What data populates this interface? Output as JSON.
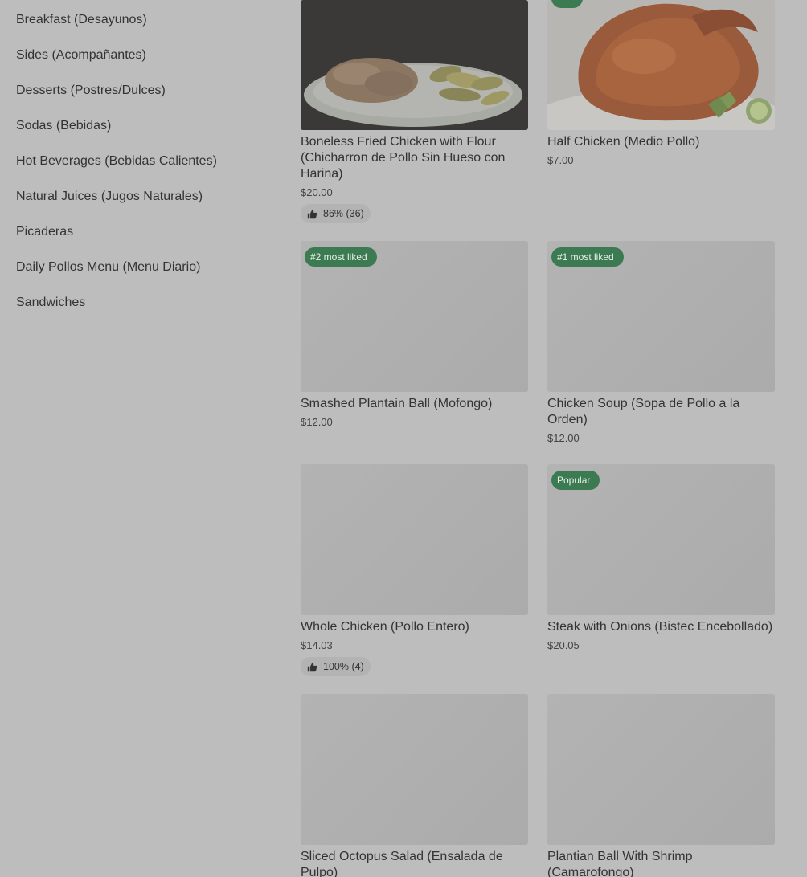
{
  "sidebar": {
    "items": [
      {
        "label": "Breakfast (Desayunos)"
      },
      {
        "label": "Sides (Acompañantes)"
      },
      {
        "label": "Desserts (Postres/Dulces)"
      },
      {
        "label": "Sodas (Bebidas)"
      },
      {
        "label": "Hot Beverages (Bebidas Calientes)"
      },
      {
        "label": "Natural Juices (Jugos Naturales)"
      },
      {
        "label": "Picaderas"
      },
      {
        "label": "Daily Pollos Menu (Menu Diario)"
      },
      {
        "label": "Sandwiches"
      }
    ]
  },
  "menu": {
    "items": [
      {
        "title": "Boneless Fried Chicken with Flour (Chicharron de Pollo Sin Hueso con Harina)",
        "price": "$20.00",
        "rating": "86% (36)",
        "image": "fried-chicken-plantains-photo"
      },
      {
        "title": "Half Chicken  (Medio Pollo)",
        "price": "$7.00",
        "image": "roast-chicken-photo"
      },
      {
        "title": "Smashed Plantain Ball (Mofongo)",
        "price": "$12.00",
        "badge": "#2 most liked"
      },
      {
        "title": "Chicken Soup (Sopa de Pollo a la Orden)",
        "price": "$12.00",
        "badge": "#1 most liked"
      },
      {
        "title": "Whole Chicken (Pollo Entero)",
        "price": "$14.03",
        "rating": "100% (4)"
      },
      {
        "title": "Steak with Onions (Bistec Encebollado)",
        "price": "$20.05",
        "badge": "Popular"
      },
      {
        "title": "Sliced Octopus Salad (Ensalada de Pulpo)"
      },
      {
        "title": "Plantian Ball With Shrimp (Camarofongo)"
      }
    ]
  },
  "colors": {
    "overlay_background": "#bdbdbd",
    "badge_green": "#3c7a52"
  },
  "icons": {
    "rating": "thumbs-up-icon"
  }
}
